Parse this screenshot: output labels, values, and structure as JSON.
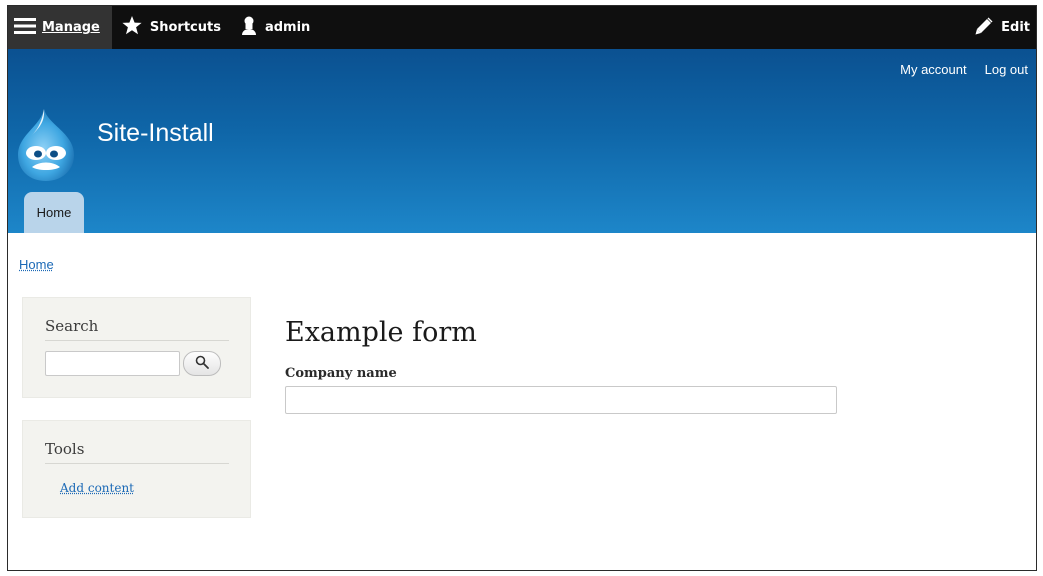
{
  "toolbar": {
    "manage_label": "Manage",
    "shortcuts_label": "Shortcuts",
    "user_label": "admin",
    "edit_label": "Edit"
  },
  "header": {
    "secondary_menu": [
      "My account",
      "Log out"
    ],
    "site_name": "Site-Install",
    "tabs": [
      {
        "label": "Home"
      }
    ]
  },
  "breadcrumb": {
    "items": [
      "Home"
    ]
  },
  "sidebar": {
    "search_block": {
      "title": "Search",
      "input_value": ""
    },
    "tools_block": {
      "title": "Tools",
      "links": [
        "Add content"
      ]
    }
  },
  "main": {
    "title": "Example form",
    "fields": [
      {
        "label": "Company name",
        "value": ""
      }
    ]
  },
  "colors": {
    "toolbar_bg": "#0f0f0f",
    "header_top": "#0b5191",
    "header_bottom": "#1d86c9",
    "link": "#1b69b6",
    "active_tab": "#b9d4ea",
    "block_bg": "#f3f3ef"
  },
  "icons": {
    "manage": "hamburger-icon",
    "shortcuts": "star-icon",
    "user": "user-icon",
    "edit": "pencil-icon",
    "search": "magnifier-icon",
    "logo": "drupal-drop-logo"
  }
}
